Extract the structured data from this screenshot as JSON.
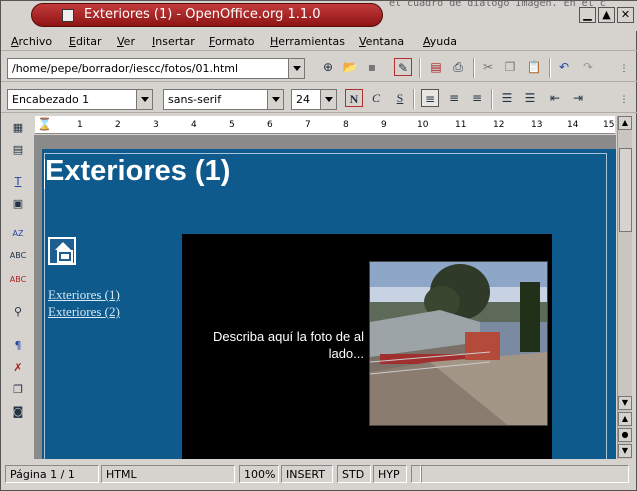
{
  "window": {
    "title": "Exteriores (1) - OpenOffice.org 1.1.0",
    "background_text": "el cuadro de diálogo Imagen. En el c"
  },
  "menu": [
    "Archivo",
    "Editar",
    "Ver",
    "Insertar",
    "Formato",
    "Herramientas",
    "Ventana",
    "Ayuda"
  ],
  "toolbar": {
    "url": "/home/pepe/borrador/iescc/fotos/01.html",
    "paragraph_style": "Encabezado 1",
    "font_name": "sans-serif",
    "font_size": "24",
    "bold_label": "N",
    "italic_label": "C",
    "underline_label": "S"
  },
  "ruler": [
    "1",
    "2",
    "3",
    "4",
    "5",
    "6",
    "7",
    "8",
    "9",
    "10",
    "11",
    "12",
    "13",
    "14",
    "15"
  ],
  "document": {
    "heading": "Exteriores (1)",
    "links": [
      "Exteriores (1)",
      "Exteriores (2)"
    ],
    "caption": "Describa aquí la foto de al lado..."
  },
  "status": {
    "page": "Página  1 / 1",
    "mode": "HTML",
    "zoom": "100%",
    "insert": "INSERT",
    "std": "STD",
    "hyp": "HYP"
  },
  "colors": {
    "page_background": "#0e5a8c",
    "title_bar": "#a82424",
    "photo_frame": "#000000"
  }
}
